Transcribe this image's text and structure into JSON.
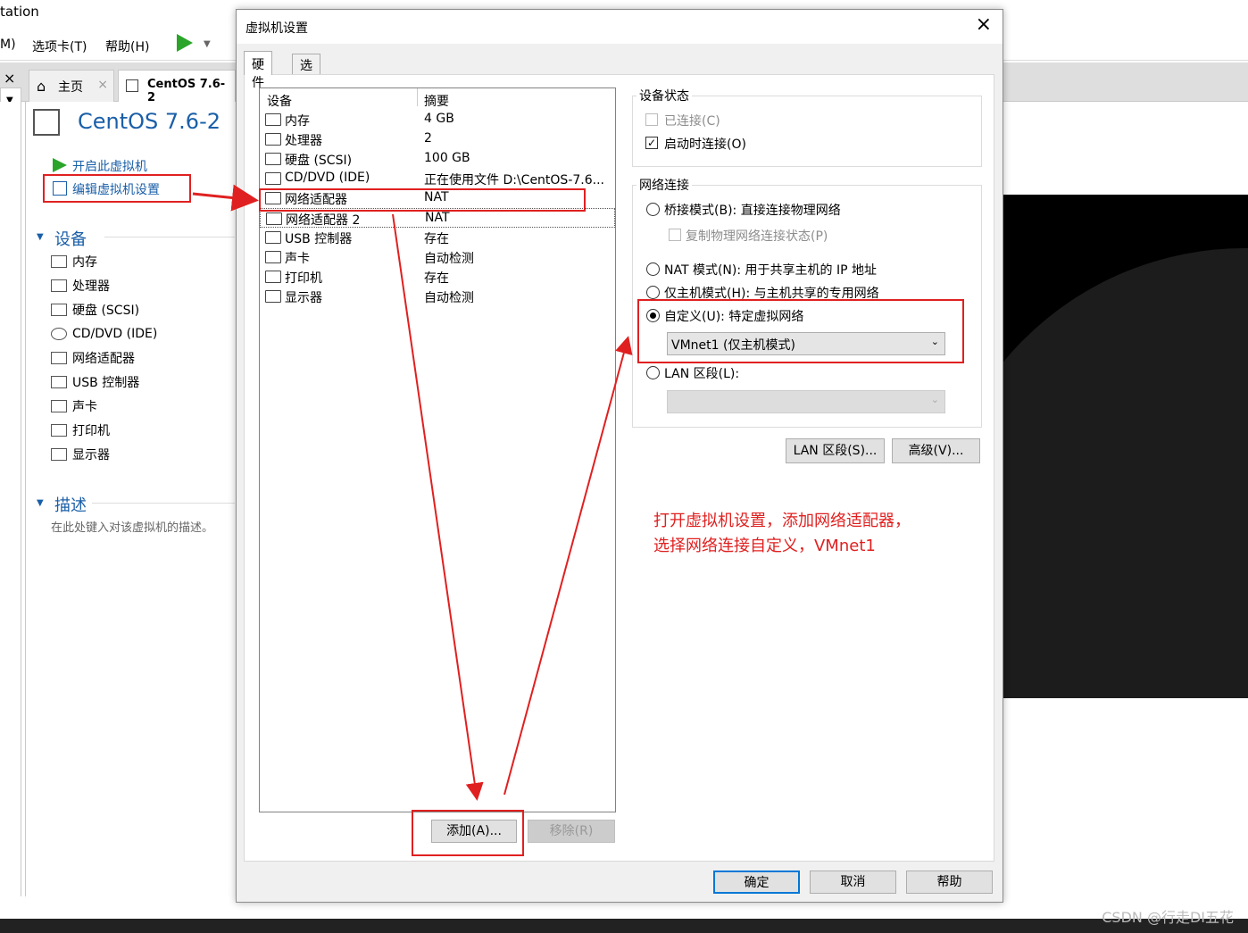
{
  "bg": {
    "window_title": "tation",
    "menu": [
      "M)",
      "选项卡(T)",
      "帮助(H)"
    ],
    "close_x": "×",
    "tabs": [
      {
        "label": "主页"
      },
      {
        "label": "CentOS 7.6-2"
      }
    ],
    "vm_title": "CentOS 7.6-2",
    "actions": {
      "start": "开启此虚拟机",
      "edit": "编辑虚拟机设置"
    },
    "devices_header": "设备",
    "devices": [
      "内存",
      "处理器",
      "硬盘 (SCSI)",
      "CD/DVD (IDE)",
      "网络适配器",
      "USB 控制器",
      "声卡",
      "打印机",
      "显示器"
    ],
    "desc_header": "描述",
    "desc_placeholder": "在此处键入对该虚拟机的描述。"
  },
  "dialog": {
    "title": "虚拟机设置",
    "tabs": [
      "硬件",
      "选项"
    ],
    "list_headers": {
      "device": "设备",
      "summary": "摘要"
    },
    "devices": [
      {
        "name": "内存",
        "summary": "4 GB",
        "icon": "memory-icon"
      },
      {
        "name": "处理器",
        "summary": "2",
        "icon": "cpu-icon"
      },
      {
        "name": "硬盘 (SCSI)",
        "summary": "100 GB",
        "icon": "disk-icon"
      },
      {
        "name": "CD/DVD (IDE)",
        "summary": "正在使用文件 D:\\CentOS-7.6...",
        "icon": "cd-icon"
      },
      {
        "name": "网络适配器",
        "summary": "NAT",
        "icon": "network-icon"
      },
      {
        "name": "网络适配器 2",
        "summary": "NAT",
        "icon": "network-icon"
      },
      {
        "name": "USB 控制器",
        "summary": "存在",
        "icon": "usb-icon"
      },
      {
        "name": "声卡",
        "summary": "自动检测",
        "icon": "sound-icon"
      },
      {
        "name": "打印机",
        "summary": "存在",
        "icon": "printer-icon"
      },
      {
        "name": "显示器",
        "summary": "自动检测",
        "icon": "display-icon"
      }
    ],
    "add_button": "添加(A)...",
    "remove_button": "移除(R)",
    "device_status": {
      "label": "设备状态",
      "connected": "已连接(C)",
      "connect_on_power": "启动时连接(O)"
    },
    "network": {
      "label": "网络连接",
      "bridged": "桥接模式(B): 直接连接物理网络",
      "replicate": "复制物理网络连接状态(P)",
      "nat": "NAT 模式(N): 用于共享主机的 IP 地址",
      "host_only": "仅主机模式(H): 与主机共享的专用网络",
      "custom": "自定义(U): 特定虚拟网络",
      "custom_value": "VMnet1 (仅主机模式)",
      "lan": "LAN 区段(L):"
    },
    "lan_segments_button": "LAN 区段(S)...",
    "advanced_button": "高级(V)...",
    "ok": "确定",
    "cancel": "取消",
    "help": "帮助",
    "close": "×"
  },
  "annotation": {
    "line1": "打开虚拟机设置，添加网络适配器，",
    "line2": "选择网络连接自定义，VMnet1"
  },
  "watermark": "CSDN @行走DI五花",
  "colors": {
    "accent": "#1a5fa8",
    "annotation": "#e02020"
  }
}
